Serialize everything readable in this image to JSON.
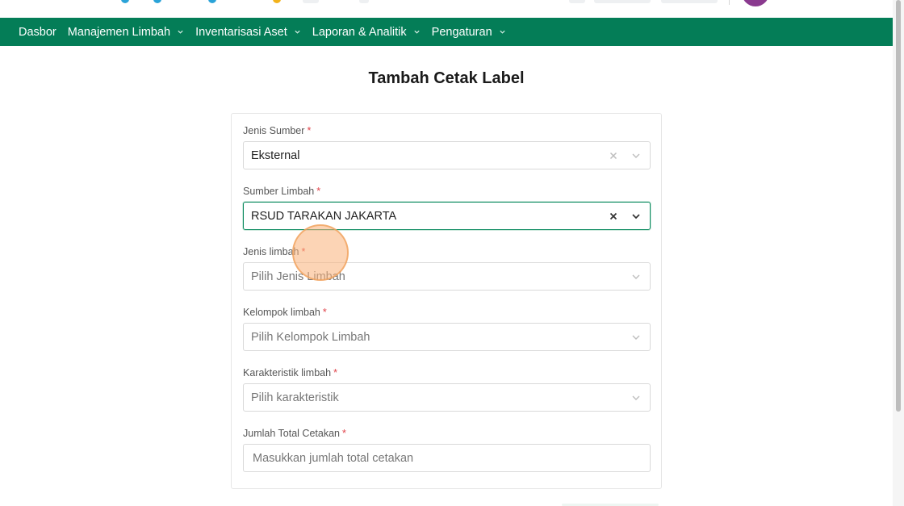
{
  "navbar": {
    "items": [
      {
        "label": "Dasbor",
        "has_dropdown": false
      },
      {
        "label": "Manajemen Limbah",
        "has_dropdown": true
      },
      {
        "label": "Inventarisasi Aset",
        "has_dropdown": true
      },
      {
        "label": "Laporan & Analitik",
        "has_dropdown": true
      },
      {
        "label": "Pengaturan",
        "has_dropdown": true
      }
    ],
    "background": "#047d57"
  },
  "page": {
    "title": "Tambah Cetak Label"
  },
  "form": {
    "required_mark": "*",
    "jenis_sumber": {
      "label": "Jenis Sumber",
      "value": "Eksternal"
    },
    "sumber_limbah": {
      "label": "Sumber Limbah",
      "value": "RSUD TARAKAN JAKARTA"
    },
    "jenis_limbah": {
      "label": "Jenis limbah",
      "placeholder": "Pilih Jenis Limbah"
    },
    "kelompok_limbah": {
      "label": "Kelompok limbah",
      "placeholder": "Pilih Kelompok Limbah"
    },
    "karakteristik_limbah": {
      "label": "Karakteristik limbah",
      "placeholder": "Pilih karakteristik"
    },
    "jumlah_total_cetakan": {
      "label": "Jumlah Total Cetakan",
      "placeholder": "Masukkan jumlah total cetakan"
    }
  },
  "icons": {
    "clear": "close-icon",
    "dropdown": "chevron-down-icon"
  },
  "colors": {
    "accent": "#047d57",
    "required": "#e0434a",
    "focus_border": "#0b8a5f",
    "avatar": "#8a3a8f"
  }
}
